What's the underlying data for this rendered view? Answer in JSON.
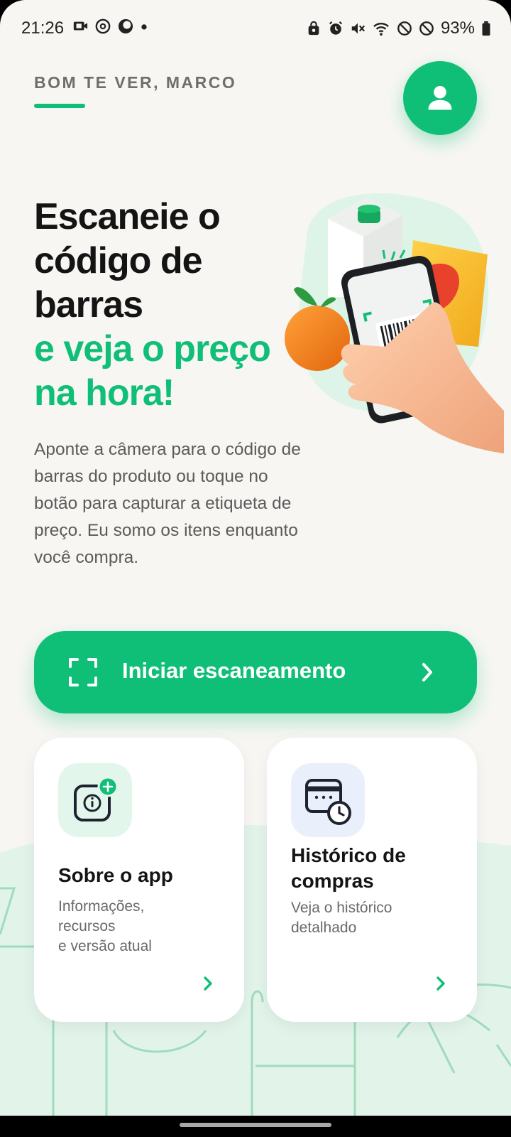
{
  "status_bar": {
    "time": "21:26",
    "battery_percent": "93%",
    "left_icons": [
      "screen-record-icon",
      "threads-icon",
      "chrome-icon",
      "dot-icon"
    ],
    "right_icons": [
      "lock-icon",
      "alarm-icon",
      "mute-icon",
      "wifi-icon",
      "block-icon",
      "block-icon",
      "battery-icon"
    ]
  },
  "header": {
    "greeting": "BOM TE VER, MARCO",
    "profile_icon": "user-icon"
  },
  "hero": {
    "title_line1": "Escaneie o",
    "title_line2": "código de",
    "title_line3": "barras",
    "title_green_line1": "e veja o preço",
    "title_green_line2": "na hora!",
    "description": "Aponte a câmera para o código de barras do produto ou toque no botão para capturar a etiqueta de preço. Eu somo os itens enquanto você compra.",
    "illustration": "hand-scanning-groceries-illustration"
  },
  "scan_button": {
    "label": "Iniciar escaneamento",
    "icon": "scan-frame-icon"
  },
  "cards": [
    {
      "title": "Sobre o app",
      "desc_line1": "Informações,",
      "desc_line2": "recursos",
      "desc_line3": "e versão atual",
      "icon": "info-app-icon"
    },
    {
      "title_line1": "Histórico de",
      "title_line2": "compras",
      "desc_line1": "Veja o histórico",
      "desc_line2": "detalhado",
      "icon": "calendar-clock-icon"
    }
  ],
  "colors": {
    "accent": "#10bf77",
    "background": "#f7f6f3",
    "text_dark": "#141414",
    "text_muted": "#5b5b5b"
  }
}
